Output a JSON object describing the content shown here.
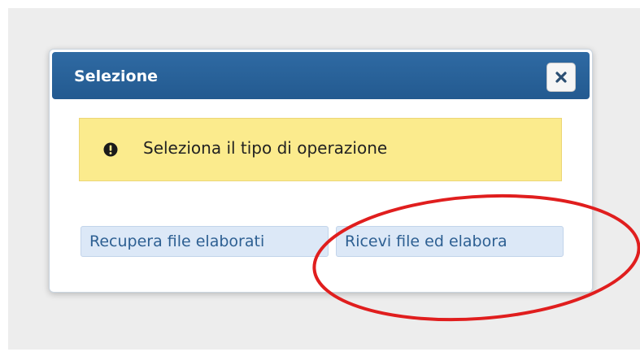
{
  "dialog": {
    "title": "Selezione",
    "close_icon": "close-icon",
    "alert": {
      "icon": "exclamation-circle-icon",
      "message": "Seleziona il tipo di operazione"
    },
    "buttons": [
      {
        "label": "Recupera file elaborati"
      },
      {
        "label": "Ricevi file ed elabora"
      }
    ]
  },
  "colors": {
    "titlebar": "#2f6aa3",
    "alert_background": "#fbeb8d",
    "button_background": "#dce8f7",
    "button_text": "#2d5f92",
    "annotation": "#e01e1e"
  }
}
